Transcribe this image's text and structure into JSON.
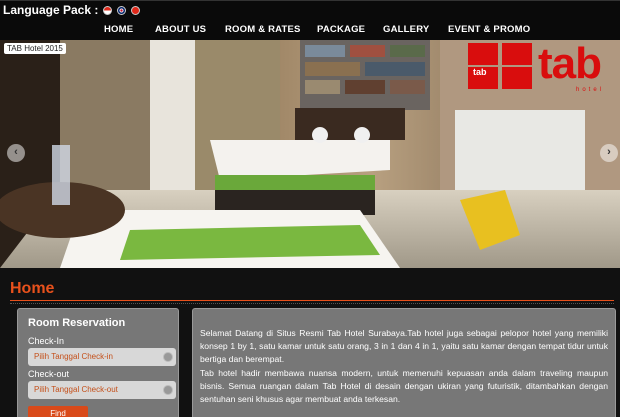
{
  "header": {
    "language_label": "Language Pack :",
    "flags": [
      "indonesia-flag",
      "uk-flag",
      "japan-flag"
    ]
  },
  "nav": {
    "items": [
      "HOME",
      "ABOUT US",
      "ROOM & RATES",
      "PACKAGE",
      "GALLERY",
      "EVENT & PROMO"
    ]
  },
  "hero": {
    "caption": "TAB Hotel 2015",
    "prev_icon": "chevron-left-icon",
    "next_icon": "chevron-right-icon",
    "logo": {
      "main": "tab",
      "small": "tab",
      "sub": "hotel"
    }
  },
  "main": {
    "title": "Home",
    "reservation": {
      "title": "Room Reservation",
      "checkin_label": "Check-In",
      "checkin_placeholder": "Pilih Tanggal Check-in",
      "checkout_label": "Check-out",
      "checkout_placeholder": "Pilih Tanggal Check-out",
      "find_label": "Find"
    },
    "description": {
      "p1": "Selamat Datang di Situs Resmi Tab Hotel Surabaya.Tab hotel juga sebagai pelopor hotel yang memiliki konsep 1 by 1, satu kamar untuk satu orang, 3 in 1 dan 4 in 1, yaitu satu kamar dengan tempat tidur untuk bertiga dan berempat.",
      "p2": "Tab hotel hadir membawa nuansa modern, untuk memenuhi kepuasan anda dalam traveling maupun bisnis. Semua ruangan dalam Tab Hotel di desain dengan ukiran yang futuristik, ditambahkan dengan sentuhan seni khusus agar membuat anda terkesan."
    }
  },
  "colors": {
    "accent": "#e8511c",
    "brand_red": "#d90d0d",
    "panel": "#777777"
  }
}
